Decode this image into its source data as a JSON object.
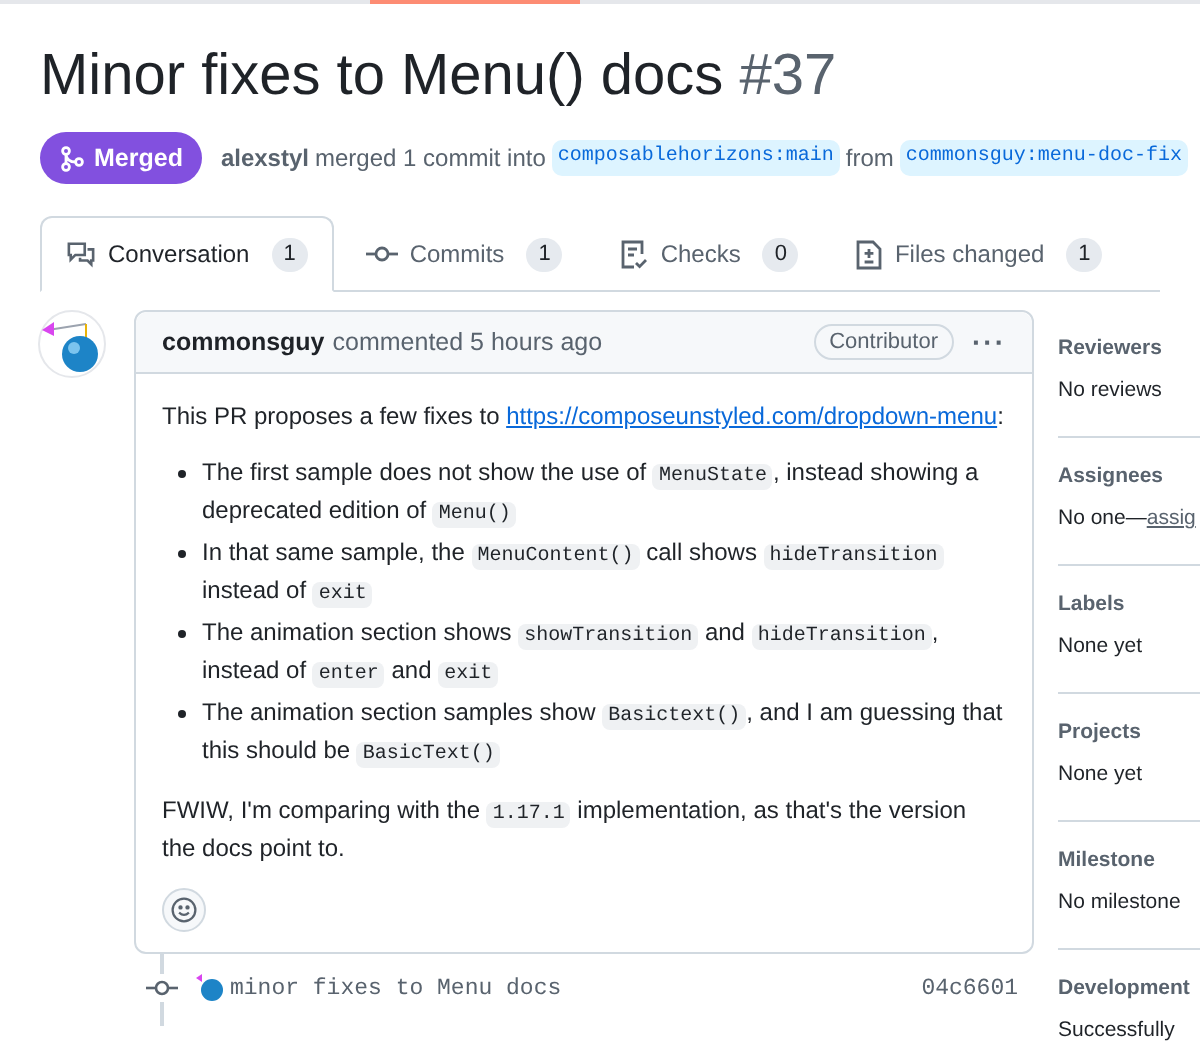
{
  "title": {
    "text": "Minor fixes to Menu() docs",
    "number": "#37"
  },
  "status": {
    "label": "Merged"
  },
  "merge_info": {
    "author": "alexstyl",
    "text": "merged 1 commit into",
    "base": "composablehorizons:main",
    "from": "from",
    "head": "commonsguy:menu-doc-fix"
  },
  "tabs": [
    {
      "label": "Conversation",
      "count": "1",
      "selected": true
    },
    {
      "label": "Commits",
      "count": "1",
      "selected": false
    },
    {
      "label": "Checks",
      "count": "0",
      "selected": false
    },
    {
      "label": "Files changed",
      "count": "1",
      "selected": false
    }
  ],
  "comment": {
    "author": "commonsguy",
    "action": "commented 5 hours ago",
    "badge": "Contributor",
    "menu": "···",
    "intro": [
      {
        "kind": "text",
        "text": "This PR proposes a few fixes to "
      },
      {
        "kind": "link",
        "text": "https://composeunstyled.com/dropdown-"
      },
      {
        "kind": "link",
        "text": "menu"
      },
      {
        "kind": "text",
        "text": ":"
      }
    ],
    "bullets": [
      [
        {
          "kind": "text",
          "text": "The first sample does not show the use of "
        },
        {
          "kind": "code",
          "text": "MenuState"
        },
        {
          "kind": "text",
          "text": ", instead showing a deprecated edition of "
        },
        {
          "kind": "code",
          "text": "Menu()"
        }
      ],
      [
        {
          "kind": "text",
          "text": "In that same sample, the "
        },
        {
          "kind": "code",
          "text": "MenuContent()"
        },
        {
          "kind": "text",
          "text": " call shows "
        },
        {
          "kind": "code",
          "text": "hideTransition"
        },
        {
          "kind": "text",
          "text": " instead of "
        },
        {
          "kind": "code",
          "text": "exit"
        }
      ],
      [
        {
          "kind": "text",
          "text": "The animation section shows "
        },
        {
          "kind": "code",
          "text": "showTransition"
        },
        {
          "kind": "text",
          "text": " and "
        },
        {
          "kind": "code",
          "text": "hideTransition"
        },
        {
          "kind": "text",
          "text": ", instead of "
        },
        {
          "kind": "code",
          "text": "enter"
        },
        {
          "kind": "text",
          "text": " and "
        },
        {
          "kind": "code",
          "text": "exit"
        }
      ],
      [
        {
          "kind": "text",
          "text": "The animation section samples show "
        },
        {
          "kind": "code",
          "text": "Basictext()"
        },
        {
          "kind": "text",
          "text": ", and I am guessing that this should be "
        },
        {
          "kind": "code",
          "text": "BasicText()"
        }
      ]
    ],
    "outro": [
      {
        "kind": "text",
        "text": "FWIW, I'm comparing with the "
      },
      {
        "kind": "code",
        "text": "1.17.1"
      },
      {
        "kind": "text",
        "text": " implementation, as that's the version the docs point to."
      }
    ]
  },
  "commit": {
    "message": "minor fixes to Menu docs",
    "sha": "04c6601"
  },
  "sidebar": [
    {
      "heading": "Reviewers",
      "value": "No reviews"
    },
    {
      "heading": "Assignees",
      "value": "No one—",
      "link": "assig"
    },
    {
      "heading": "Labels",
      "value": "None yet"
    },
    {
      "heading": "Projects",
      "value": "None yet"
    },
    {
      "heading": "Milestone",
      "value": "No milestone"
    },
    {
      "heading": "Development",
      "value": "Successfully"
    }
  ]
}
